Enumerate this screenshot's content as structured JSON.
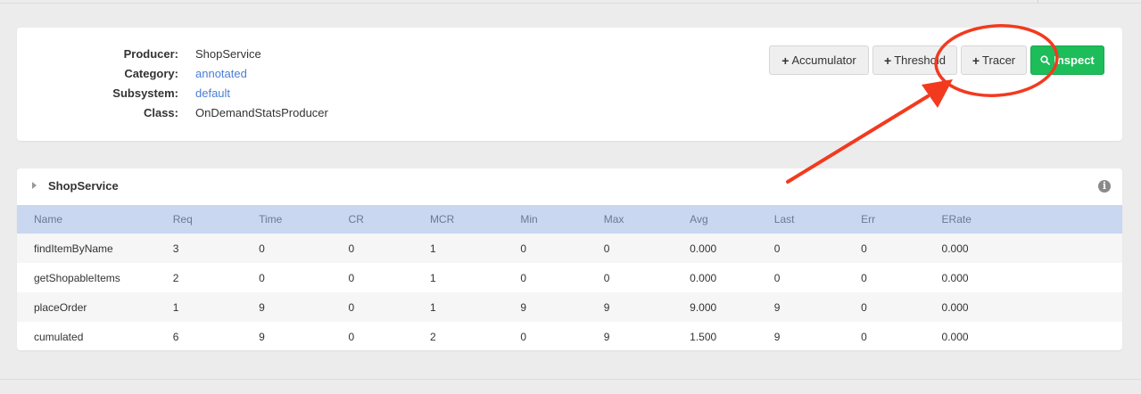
{
  "producer_info": {
    "rows": [
      {
        "label": "Producer:",
        "value": "ShopService",
        "link": false
      },
      {
        "label": "Category:",
        "value": "annotated",
        "link": true
      },
      {
        "label": "Subsystem:",
        "value": "default",
        "link": true
      },
      {
        "label": "Class:",
        "value": "OnDemandStatsProducer",
        "link": false
      }
    ]
  },
  "toolbar": {
    "accumulator_label": "Accumulator",
    "threshold_label": "Threshold",
    "tracer_label": "Tracer",
    "inspect_label": "Inspect",
    "inspect_color": "#1dbd5a"
  },
  "section": {
    "title": "ShopService",
    "info_icon": "info-circle-icon"
  },
  "table": {
    "columns": [
      "Name",
      "Req",
      "Time",
      "CR",
      "MCR",
      "Min",
      "Max",
      "Avg",
      "Last",
      "Err",
      "ERate"
    ],
    "rows": [
      [
        "findItemByName",
        "3",
        "0",
        "0",
        "1",
        "0",
        "0",
        "0.000",
        "0",
        "0",
        "0.000"
      ],
      [
        "getShopableItems",
        "2",
        "0",
        "0",
        "1",
        "0",
        "0",
        "0.000",
        "0",
        "0",
        "0.000"
      ],
      [
        "placeOrder",
        "1",
        "9",
        "0",
        "1",
        "9",
        "9",
        "9.000",
        "9",
        "0",
        "0.000"
      ],
      [
        "cumulated",
        "6",
        "9",
        "0",
        "2",
        "0",
        "9",
        "1.500",
        "9",
        "0",
        "0.000"
      ]
    ]
  },
  "annotation": {
    "color": "#f23a1f"
  }
}
